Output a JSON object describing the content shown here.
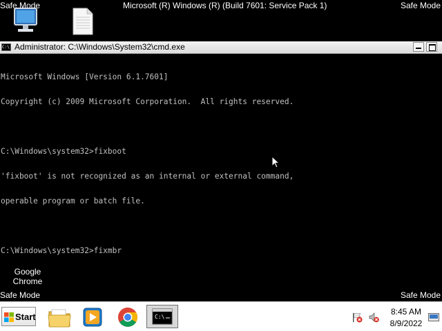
{
  "desktop": {
    "safe_mode_label": "Safe Mode",
    "build_text": "Microsoft (R) Windows (R) (Build 7601: Service Pack 1)",
    "icons": [
      {
        "name": "computer-icon"
      },
      {
        "name": "document-icon"
      }
    ],
    "chrome_shortcut_label": "Google Chrome"
  },
  "cmd": {
    "title": "Administrator: C:\\Windows\\System32\\cmd.exe",
    "lines": [
      "Microsoft Windows [Version 6.1.7601]",
      "Copyright (c) 2009 Microsoft Corporation.  All rights reserved.",
      "",
      "C:\\Windows\\system32>fixboot",
      "'fixboot' is not recognized as an internal or external command,",
      "operable program or batch file.",
      "",
      "C:\\Windows\\system32>fixmbr"
    ],
    "text_color": "#c0c0c0",
    "background": "#000000"
  },
  "taskbar": {
    "start_label": "Start",
    "pinned": [
      {
        "name": "windows-explorer-icon"
      },
      {
        "name": "media-player-icon"
      },
      {
        "name": "google-chrome-icon"
      },
      {
        "name": "cmd-icon",
        "active": true
      }
    ],
    "tray": {
      "icons": [
        "action-center-flag-icon",
        "volume-muted-icon"
      ],
      "time": "8:45 AM",
      "date": "8/9/2022"
    }
  }
}
